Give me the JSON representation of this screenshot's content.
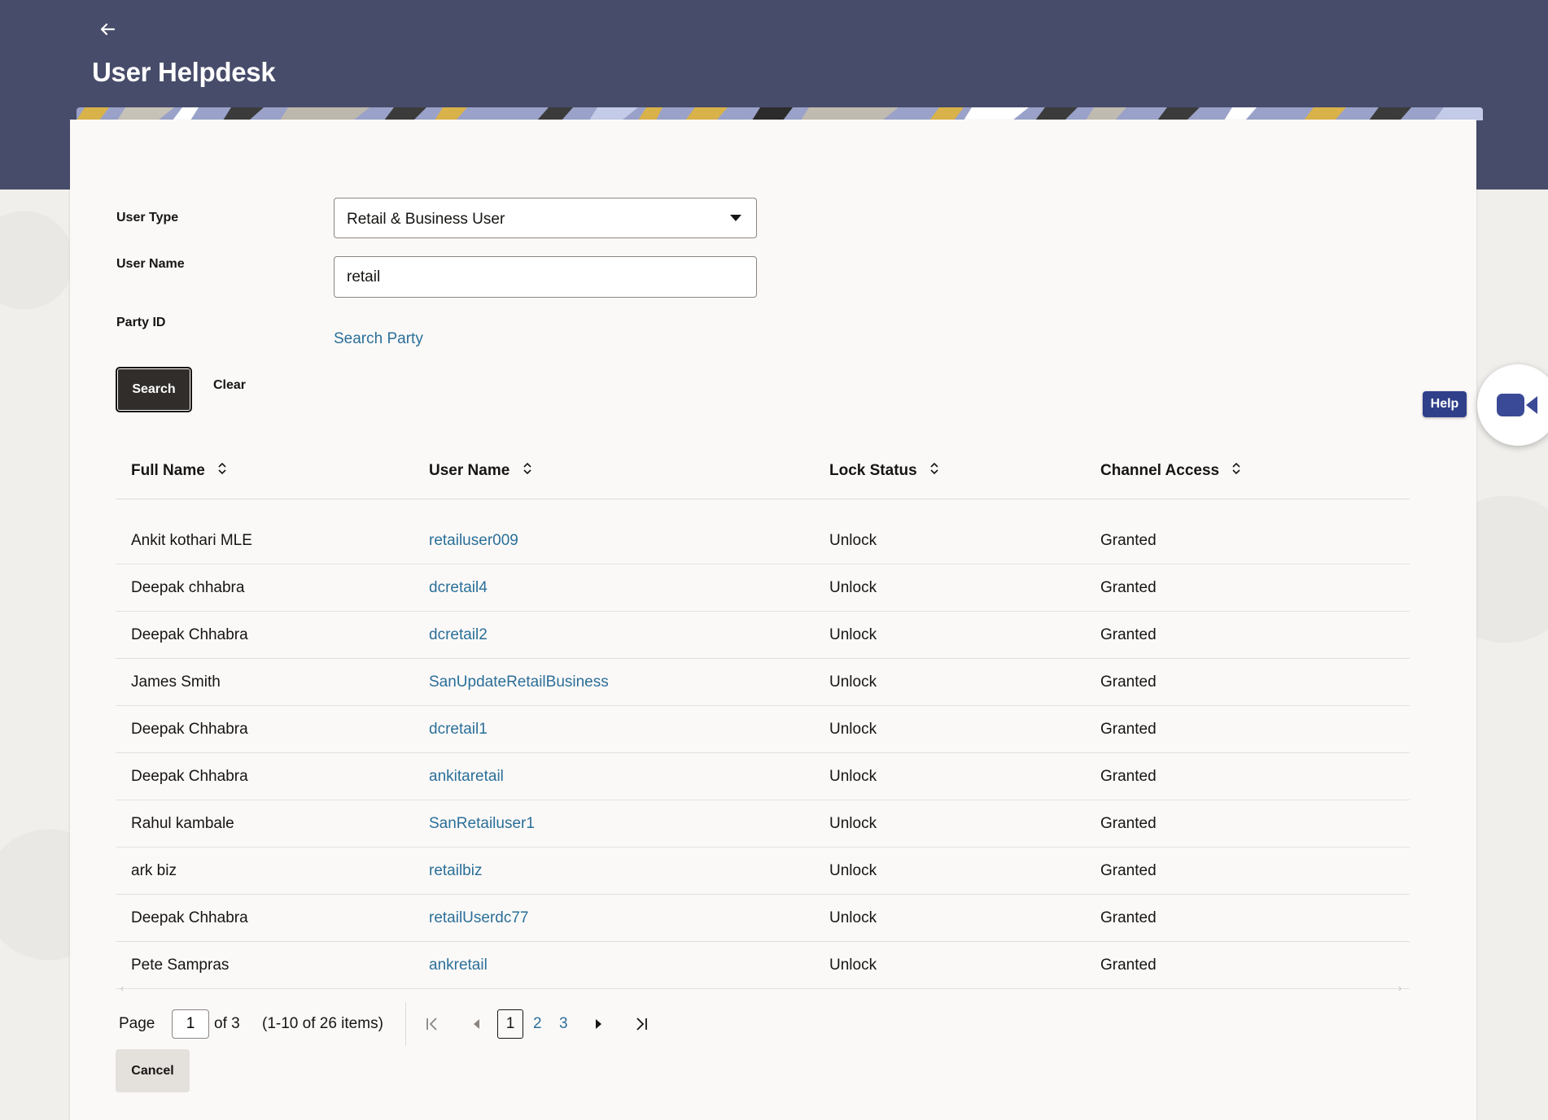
{
  "header": {
    "title": "User Helpdesk",
    "back_icon": "arrow-left-icon",
    "background_color": "#474c6a"
  },
  "form": {
    "user_type_label": "User Type",
    "user_type_value": "Retail & Business User",
    "user_name_label": "User Name",
    "user_name_value": "retail",
    "party_id_label": "Party ID",
    "search_party_link": "Search Party",
    "search_button": "Search",
    "clear_button": "Clear"
  },
  "help": {
    "label": "Help",
    "icon": "video-camera-icon"
  },
  "table": {
    "columns": [
      "Full Name",
      "User Name",
      "Lock Status",
      "Channel Access"
    ],
    "rows": [
      {
        "full_name": "Ankit kothari MLE",
        "user_name": "retailuser009",
        "lock_status": "Unlock",
        "channel_access": "Granted"
      },
      {
        "full_name": "Deepak chhabra",
        "user_name": "dcretail4",
        "lock_status": "Unlock",
        "channel_access": "Granted"
      },
      {
        "full_name": "Deepak Chhabra",
        "user_name": "dcretail2",
        "lock_status": "Unlock",
        "channel_access": "Granted"
      },
      {
        "full_name": "James Smith",
        "user_name": "SanUpdateRetailBusiness",
        "lock_status": "Unlock",
        "channel_access": "Granted"
      },
      {
        "full_name": "Deepak Chhabra",
        "user_name": "dcretail1",
        "lock_status": "Unlock",
        "channel_access": "Granted"
      },
      {
        "full_name": "Deepak Chhabra",
        "user_name": "ankitaretail",
        "lock_status": "Unlock",
        "channel_access": "Granted"
      },
      {
        "full_name": "Rahul kambale",
        "user_name": "SanRetailuser1",
        "lock_status": "Unlock",
        "channel_access": "Granted"
      },
      {
        "full_name": "ark biz",
        "user_name": "retailbiz",
        "lock_status": "Unlock",
        "channel_access": "Granted"
      },
      {
        "full_name": "Deepak Chhabra",
        "user_name": "retailUserdc77",
        "lock_status": "Unlock",
        "channel_access": "Granted"
      },
      {
        "full_name": "Pete Sampras",
        "user_name": "ankretail",
        "lock_status": "Unlock",
        "channel_access": "Granted"
      }
    ]
  },
  "pagination": {
    "page_label": "Page",
    "current_page": "1",
    "of_label": "of 3",
    "items_label": "(1-10 of 26 items)",
    "pages": [
      "1",
      "2",
      "3"
    ]
  },
  "footer": {
    "cancel_button": "Cancel"
  },
  "colors": {
    "link": "#2b6f98",
    "primary_button": "#312d2a",
    "help_badge": "#2f3f8a"
  }
}
